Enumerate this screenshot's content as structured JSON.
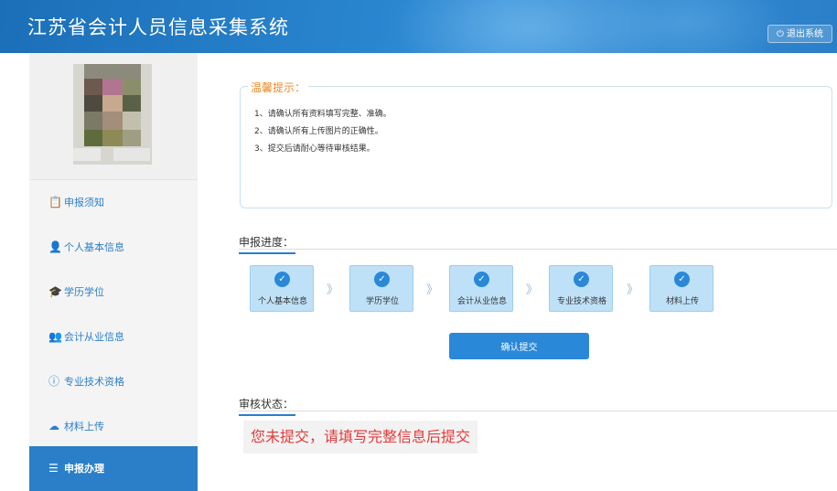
{
  "header": {
    "title": "江苏省会计人员信息采集系统",
    "logout_label": "退出系统",
    "logout_icon": "power-icon"
  },
  "sidebar": {
    "items": [
      {
        "label": "申报须知",
        "icon": "clipboard-icon"
      },
      {
        "label": "个人基本信息",
        "icon": "user-icon"
      },
      {
        "label": "学历学位",
        "icon": "graduation-cap-icon"
      },
      {
        "label": "会计从业信息",
        "icon": "users-icon"
      },
      {
        "label": "专业技术资格",
        "icon": "info-circle-icon"
      },
      {
        "label": "材料上传",
        "icon": "cloud-upload-icon"
      },
      {
        "label": "申报办理",
        "icon": "list-icon",
        "active": true
      }
    ]
  },
  "tips": {
    "title": "温馨提示：",
    "lines": [
      "1、请确认所有资料填写完整、准确。",
      "2、请确认所有上传图片的正确性。",
      "3、提交后请耐心等待审核结果。"
    ]
  },
  "progress": {
    "title": "申报进度：",
    "steps": [
      {
        "label": "个人基本信息",
        "done": true
      },
      {
        "label": "学历学位",
        "done": true
      },
      {
        "label": "会计从业信息",
        "done": true
      },
      {
        "label": "专业技术资格",
        "done": true
      },
      {
        "label": "材料上传",
        "done": true
      }
    ],
    "confirm_label": "确认提交"
  },
  "review": {
    "title": "审核状态：",
    "status": "您未提交，请填写完整信息后提交"
  },
  "colors": {
    "accent": "#2a7fc8",
    "warning_title": "#f08a24",
    "error_text": "#e23b3b"
  }
}
